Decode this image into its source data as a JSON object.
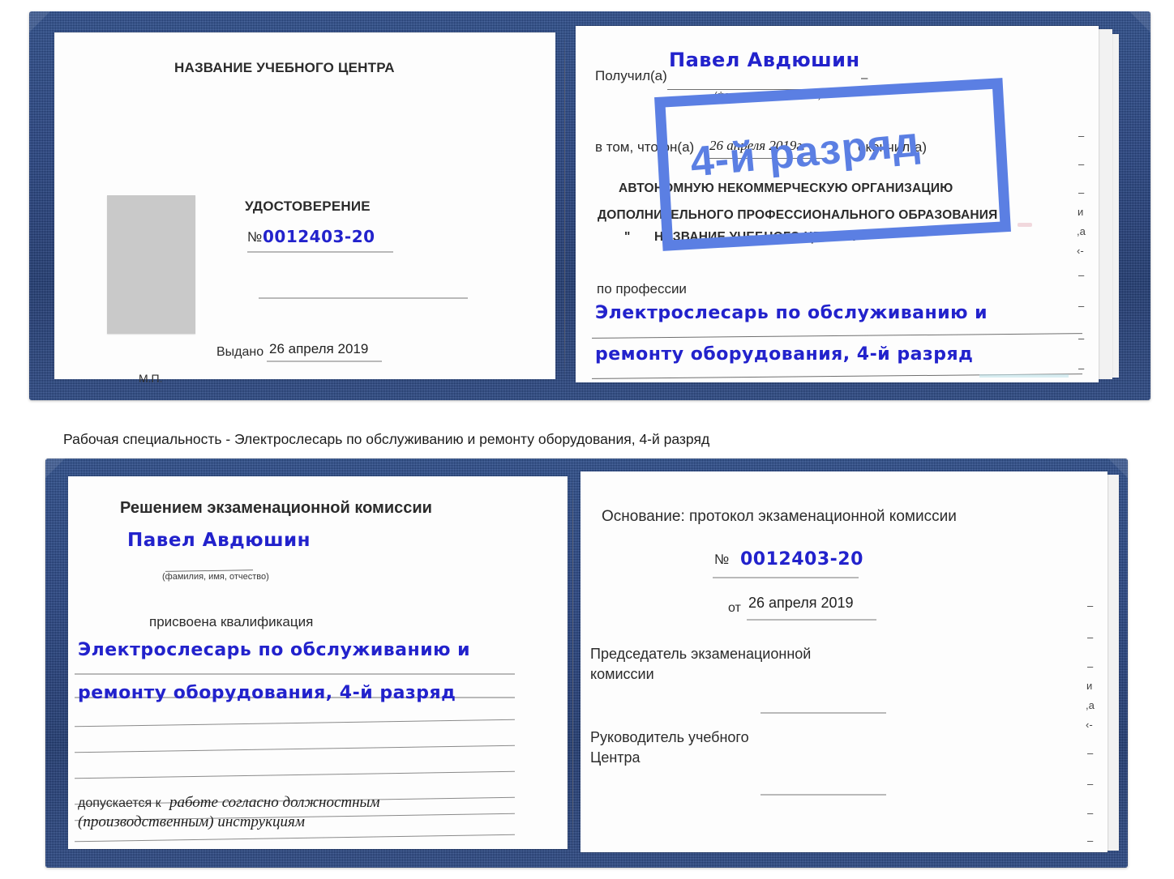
{
  "caption": {
    "text": "Рабочая специальность - Электрослесарь по обслуживанию и ремонту оборудования, 4-й разряд"
  },
  "colors": {
    "cover_blue": "#25458a",
    "ink_blue": "#2222cc",
    "stamp_blue": "#5b7fe3",
    "photo_gray": "#c9c9c9",
    "page_white": "#fdfdfd"
  },
  "certificate_top": {
    "left_page": {
      "heading": "НАЗВАНИЕ УЧЕБНОГО ЦЕНТРА",
      "doc_type": "УДОСТОВЕРЕНИЕ",
      "number_label": "№",
      "number_value": "0012403-20",
      "issued_label": "Выдано",
      "issued_value": "26 апреля 2019",
      "seal_label": "М.П.",
      "photo_alt": "photo-placeholder"
    },
    "right_page": {
      "received_label": "Получил(а)",
      "received_value": "Павел Авдюшин",
      "fio_hint": "(фамилия, имя, отчество)",
      "that_he_label": "в том, что он(а)",
      "date_value": "26 апреля 2019г.",
      "finished_label": "окончил(а)",
      "org_line1": "АВТОНОМНУЮ НЕКОММЕРЧЕСКУЮ ОРГАНИЗАЦИЮ",
      "org_line2": "ДОПОЛНИТЕЛЬНОГО ПРОФЕССИОНАЛЬНОГО ОБРАЗОВАНИЯ",
      "org_quote_open": "\"",
      "org_line3": "НАЗВАНИЕ УЧЕБНОГО ЦЕНТРА",
      "org_quote_close": "\"",
      "profession_label": "по профессии",
      "profession_line1": "Электрослесарь по обслуживанию и",
      "profession_line2": "ремонту оборудования, 4-й разряд",
      "stamp_text": "4-й разряд",
      "edge_marks": [
        "–",
        "–",
        "–",
        "и",
        "а",
        "‹-",
        "–",
        "–",
        "–",
        "–"
      ]
    }
  },
  "certificate_bottom": {
    "left_page": {
      "heading": "Решением экзаменационной комиссии",
      "name_value": "Павел Авдюшин",
      "fio_hint": "(фамилия, имя, отчество)",
      "qualification_label": "присвоена квалификация",
      "qualification_line1": "Электрослесарь по обслуживанию и",
      "qualification_line2": "ремонту оборудования, 4-й разряд",
      "admitted_label": "допускается к",
      "admitted_line1": "работе согласно должностным",
      "admitted_line2": "(производственным) инструкциям"
    },
    "right_page": {
      "basis_label": "Основание: протокол экзаменационной комиссии",
      "number_label": "№",
      "number_value": "0012403-20",
      "from_label": "от",
      "from_value": "26 апреля 2019",
      "chairman_line1": "Председатель экзаменационной",
      "chairman_line2": "комиссии",
      "head_line1": "Руководитель учебного",
      "head_line2": "Центра",
      "edge_marks": [
        "–",
        "–",
        "–",
        "и",
        "а",
        "‹-",
        "–",
        "–",
        "–",
        "–"
      ]
    }
  }
}
